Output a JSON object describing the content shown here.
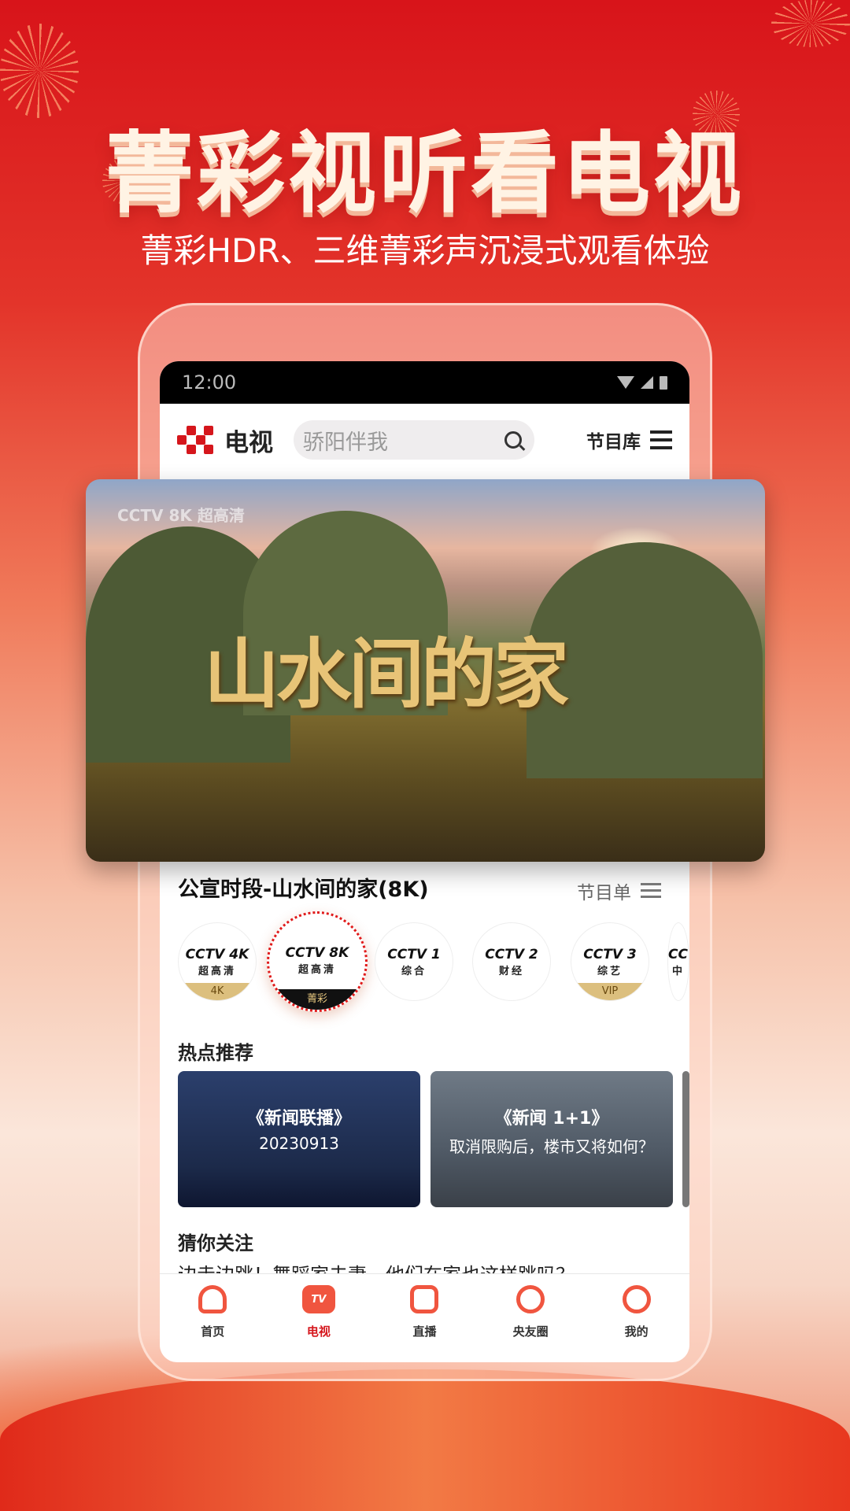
{
  "promo": {
    "headline": "菁彩视听看电视",
    "subtitle": "菁彩HDR、三维菁彩声沉浸式观看体验"
  },
  "status": {
    "time": "12:00"
  },
  "header": {
    "title": "电视",
    "search_placeholder": "骄阳伴我",
    "library": "节目库"
  },
  "hero": {
    "title": "山水间的家",
    "channel_mark": "CCTV 8K 超高清"
  },
  "now_playing": {
    "title": "公宣时段-山水间的家(8K)",
    "schedule": "节目单"
  },
  "channels": [
    {
      "logo": "CCTV 4K",
      "name": "超高清",
      "badge": "4K"
    },
    {
      "logo": "CCTV 8K",
      "name": "超高清",
      "badge": "菁彩",
      "selected": true
    },
    {
      "logo": "CCTV 1",
      "name": "综合",
      "badge": ""
    },
    {
      "logo": "CCTV 2",
      "name": "财经",
      "badge": ""
    },
    {
      "logo": "CCTV 3",
      "name": "综艺",
      "badge": "VIP"
    },
    {
      "logo": "CCTV",
      "name": "中",
      "badge": ""
    }
  ],
  "hot": {
    "title": "热点推荐",
    "cards": [
      {
        "title": "《新闻联播》",
        "subtitle": "20230913"
      },
      {
        "title": "《新闻 1+1》",
        "subtitle": "取消限购后，楼市又将如何？"
      }
    ]
  },
  "follow": {
    "title": "猜你关注",
    "teaser": "边走边跳！舞蹈家夫妻，他们在家也这样跳吗？"
  },
  "tabs": [
    {
      "label": "首页",
      "icon": "home-icon"
    },
    {
      "label": "电视",
      "icon": "tv-icon",
      "active": true,
      "glyph": "TV"
    },
    {
      "label": "直播",
      "icon": "live-icon"
    },
    {
      "label": "央友圈",
      "icon": "circle-icon"
    },
    {
      "label": "我的",
      "icon": "profile-icon"
    }
  ],
  "colors": {
    "brand": "#d5161c",
    "accent": "#f0553f",
    "gold": "#dcbf7e"
  }
}
